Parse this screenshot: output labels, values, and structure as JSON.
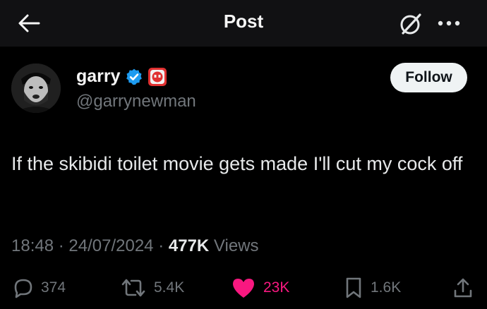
{
  "header": {
    "title": "Post",
    "back_icon": "arrow-left-icon",
    "grok_icon": "grok-icon",
    "more_icon": "more-horizontal-icon"
  },
  "author": {
    "display_name": "garry",
    "handle": "@garrynewman",
    "verified_icon": "verified-badge-icon",
    "affiliate_icon": "facepunch-badge-icon",
    "follow_label": "Follow"
  },
  "post": {
    "text": "If the skibidi toilet movie gets made I'll cut my cock off"
  },
  "meta": {
    "time": "18:48",
    "sep1": "·",
    "date": "24/07/2024",
    "sep2": "·",
    "views_count": "477K",
    "views_label": "Views"
  },
  "actions": {
    "replies": "374",
    "reposts": "5.4K",
    "likes": "23K",
    "bookmarks": "1.6K"
  },
  "colors": {
    "background": "#000000",
    "header_bg": "#111113",
    "verified_blue": "#1d9bf0",
    "like_pink": "#f91880",
    "muted": "#71767b"
  }
}
